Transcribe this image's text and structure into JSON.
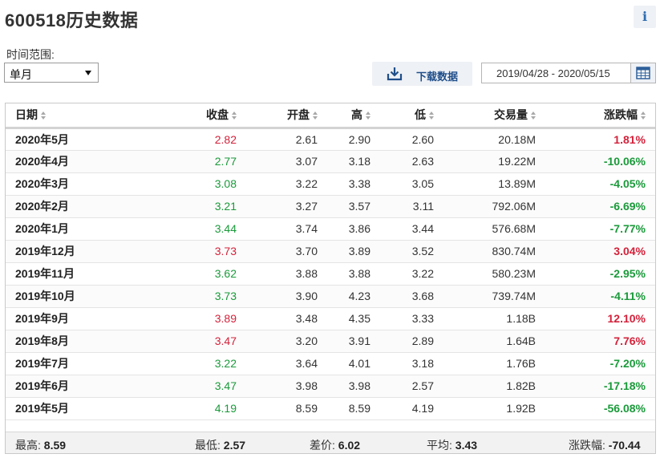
{
  "title": "600518历史数据",
  "info_glyph": "i",
  "filters": {
    "range_label": "时间范围:",
    "period_value": "单月",
    "download_label": "下载数据",
    "date_range": "2019/04/28 - 2020/05/15"
  },
  "colors": {
    "up": "#d4213a",
    "down": "#1a9a3a",
    "link": "#1f4e8a"
  },
  "table": {
    "headers": {
      "date": "日期",
      "close": "收盘",
      "open": "开盘",
      "high": "高",
      "low": "低",
      "volume": "交易量",
      "change": "涨跌幅"
    },
    "rows": [
      {
        "date": "2020年5月",
        "close": "2.82",
        "open": "2.61",
        "high": "2.90",
        "low": "2.60",
        "volume": "20.18M",
        "change": "1.81%",
        "dir": "up"
      },
      {
        "date": "2020年4月",
        "close": "2.77",
        "open": "3.07",
        "high": "3.18",
        "low": "2.63",
        "volume": "19.22M",
        "change": "-10.06%",
        "dir": "down"
      },
      {
        "date": "2020年3月",
        "close": "3.08",
        "open": "3.22",
        "high": "3.38",
        "low": "3.05",
        "volume": "13.89M",
        "change": "-4.05%",
        "dir": "down"
      },
      {
        "date": "2020年2月",
        "close": "3.21",
        "open": "3.27",
        "high": "3.57",
        "low": "3.11",
        "volume": "792.06M",
        "change": "-6.69%",
        "dir": "down"
      },
      {
        "date": "2020年1月",
        "close": "3.44",
        "open": "3.74",
        "high": "3.86",
        "low": "3.44",
        "volume": "576.68M",
        "change": "-7.77%",
        "dir": "down"
      },
      {
        "date": "2019年12月",
        "close": "3.73",
        "open": "3.70",
        "high": "3.89",
        "low": "3.52",
        "volume": "830.74M",
        "change": "3.04%",
        "dir": "up"
      },
      {
        "date": "2019年11月",
        "close": "3.62",
        "open": "3.88",
        "high": "3.88",
        "low": "3.22",
        "volume": "580.23M",
        "change": "-2.95%",
        "dir": "down"
      },
      {
        "date": "2019年10月",
        "close": "3.73",
        "open": "3.90",
        "high": "4.23",
        "low": "3.68",
        "volume": "739.74M",
        "change": "-4.11%",
        "dir": "down"
      },
      {
        "date": "2019年9月",
        "close": "3.89",
        "open": "3.48",
        "high": "4.35",
        "low": "3.33",
        "volume": "1.18B",
        "change": "12.10%",
        "dir": "up"
      },
      {
        "date": "2019年8月",
        "close": "3.47",
        "open": "3.20",
        "high": "3.91",
        "low": "2.89",
        "volume": "1.64B",
        "change": "7.76%",
        "dir": "up"
      },
      {
        "date": "2019年7月",
        "close": "3.22",
        "open": "3.64",
        "high": "4.01",
        "low": "3.18",
        "volume": "1.76B",
        "change": "-7.20%",
        "dir": "down"
      },
      {
        "date": "2019年6月",
        "close": "3.47",
        "open": "3.98",
        "high": "3.98",
        "low": "2.57",
        "volume": "1.82B",
        "change": "-17.18%",
        "dir": "down"
      },
      {
        "date": "2019年5月",
        "close": "4.19",
        "open": "8.59",
        "high": "8.59",
        "low": "4.19",
        "volume": "1.92B",
        "change": "-56.08%",
        "dir": "down"
      }
    ]
  },
  "summary": {
    "high_label": "最高:",
    "high_value": "8.59",
    "low_label": "最低:",
    "low_value": "2.57",
    "diff_label": "差价:",
    "diff_value": "6.02",
    "avg_label": "平均:",
    "avg_value": "3.43",
    "change_label": "涨跌幅:",
    "change_value": "-70.44"
  }
}
